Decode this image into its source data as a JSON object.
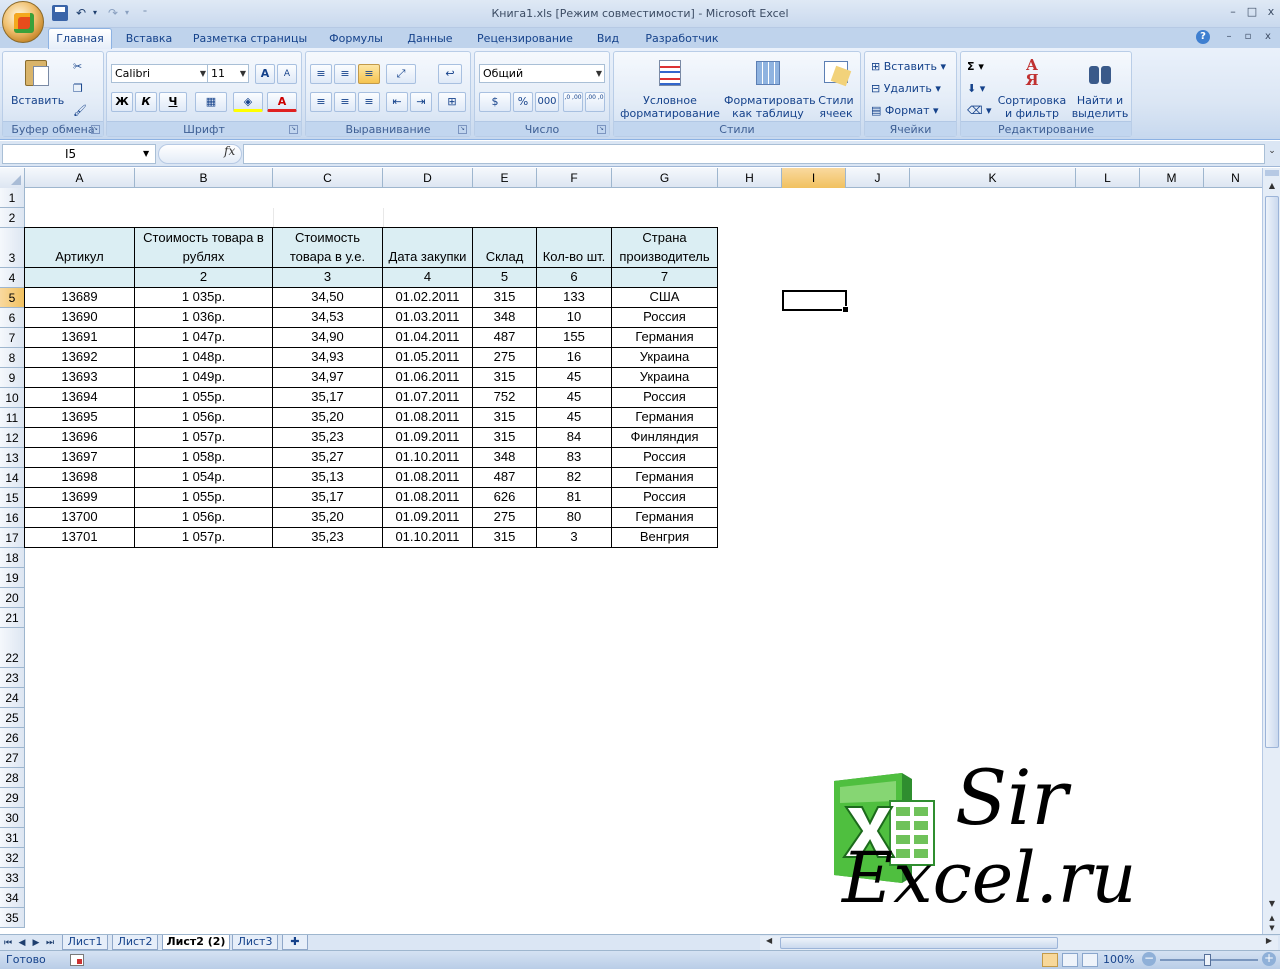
{
  "window": {
    "title": "Книга1.xls  [Режим совместимости] - Microsoft Excel",
    "minimize": "–",
    "maximize": "□",
    "close": "x"
  },
  "qat": {
    "undo": "↶",
    "undo_dd": "▾",
    "redo": "↷",
    "redo_dd": "▾",
    "customize": "⁼"
  },
  "ribbon_tabs": [
    "Главная",
    "Вставка",
    "Разметка страницы",
    "Формулы",
    "Данные",
    "Рецензирование",
    "Вид",
    "Разработчик"
  ],
  "mdi": {
    "help": "?",
    "minimize": "–",
    "restore": "▫",
    "close": "x"
  },
  "ribbon": {
    "clipboard": {
      "label": "Буфер обмена",
      "paste": "Вставить"
    },
    "font": {
      "label": "Шрифт",
      "name": "Calibri",
      "size": "11",
      "bold": "Ж",
      "italic": "К",
      "underline": "Ч",
      "grow": "A",
      "shrink": "A",
      "color_letter": "A"
    },
    "alignment": {
      "label": "Выравнивание"
    },
    "number": {
      "label": "Число",
      "format": "Общий",
      "percent": "%",
      "thousands": "000",
      "inc_dec": ",0 ,00",
      "dec_dec": ",00 ,0"
    },
    "styles": {
      "label": "Стили",
      "conditional": "Условное форматирование",
      "as_table": "Форматировать как таблицу",
      "cell_styles": "Стили ячеек"
    },
    "cells": {
      "label": "Ячейки",
      "insert": "Вставить",
      "delete": "Удалить",
      "format": "Формат"
    },
    "editing": {
      "label": "Редактирование",
      "sum": "Σ",
      "sort": "Сортировка и фильтр",
      "find": "Найти и выделить"
    }
  },
  "formula_bar": {
    "name_box": "I5",
    "fx": "fx",
    "formula": ""
  },
  "columns": [
    "A",
    "B",
    "C",
    "D",
    "E",
    "F",
    "G",
    "H",
    "I",
    "J",
    "K",
    "L",
    "M",
    "N"
  ],
  "rows": [
    "1",
    "2",
    "3",
    "4",
    "5",
    "6",
    "7",
    "8",
    "9",
    "10",
    "11",
    "12",
    "13",
    "14",
    "15",
    "16",
    "17",
    "18",
    "19",
    "20",
    "21",
    "22",
    "23",
    "24",
    "25",
    "26",
    "27",
    "28",
    "29",
    "30",
    "31",
    "32",
    "33",
    "34",
    "35"
  ],
  "table": {
    "headers": [
      "Артикул",
      "Стоимость товара в рублях",
      "Стоимость товара в у.е.",
      "Дата закупки",
      "Склад",
      "Кол-во шт.",
      "Страна производитель"
    ],
    "header_lines": [
      [
        "Артикул"
      ],
      [
        "Стоимость товара в",
        "рублях"
      ],
      [
        "Стоимость",
        "товара в у.е."
      ],
      [
        "Дата закупки"
      ],
      [
        "Склад"
      ],
      [
        "Кол-во шт."
      ],
      [
        "Страна",
        "производитель"
      ]
    ],
    "numbering": [
      "",
      "2",
      "3",
      "4",
      "5",
      "6",
      "7"
    ],
    "data": [
      [
        "13689",
        "1 035р.",
        "34,50",
        "01.02.2011",
        "315",
        "133",
        "США"
      ],
      [
        "13690",
        "1 036р.",
        "34,53",
        "01.03.2011",
        "348",
        "10",
        "Россия"
      ],
      [
        "13691",
        "1 047р.",
        "34,90",
        "01.04.2011",
        "487",
        "155",
        "Германия"
      ],
      [
        "13692",
        "1 048р.",
        "34,93",
        "01.05.2011",
        "275",
        "16",
        "Украина"
      ],
      [
        "13693",
        "1 049р.",
        "34,97",
        "01.06.2011",
        "315",
        "45",
        "Украина"
      ],
      [
        "13694",
        "1 055р.",
        "35,17",
        "01.07.2011",
        "752",
        "45",
        "Россия"
      ],
      [
        "13695",
        "1 056р.",
        "35,20",
        "01.08.2011",
        "315",
        "45",
        "Германия"
      ],
      [
        "13696",
        "1 057р.",
        "35,23",
        "01.09.2011",
        "315",
        "84",
        "Финляндия"
      ],
      [
        "13697",
        "1 058р.",
        "35,27",
        "01.10.2011",
        "348",
        "83",
        "Россия"
      ],
      [
        "13698",
        "1 054р.",
        "35,13",
        "01.08.2011",
        "487",
        "82",
        "Германия"
      ],
      [
        "13699",
        "1 055р.",
        "35,17",
        "01.08.2011",
        "626",
        "81",
        "Россия"
      ],
      [
        "13700",
        "1 056р.",
        "35,20",
        "01.09.2011",
        "275",
        "80",
        "Германия"
      ],
      [
        "13701",
        "1 057р.",
        "35,23",
        "01.10.2011",
        "315",
        "3",
        "Венгрия"
      ]
    ]
  },
  "watermark": {
    "line1": "Sir",
    "line2": "Excel.ru"
  },
  "sheet_tabs": [
    "Лист1",
    "Лист2",
    "Лист2 (2)",
    "Лист3"
  ],
  "active_sheet": "Лист2 (2)",
  "status": {
    "text": "Готово",
    "zoom": "100%",
    "zoom_minus": "−",
    "zoom_plus": "+"
  },
  "colors": {
    "header_fill": "#dbeef3",
    "selection_header": "#f1c15f",
    "ribbon": "#dbe6f4"
  }
}
